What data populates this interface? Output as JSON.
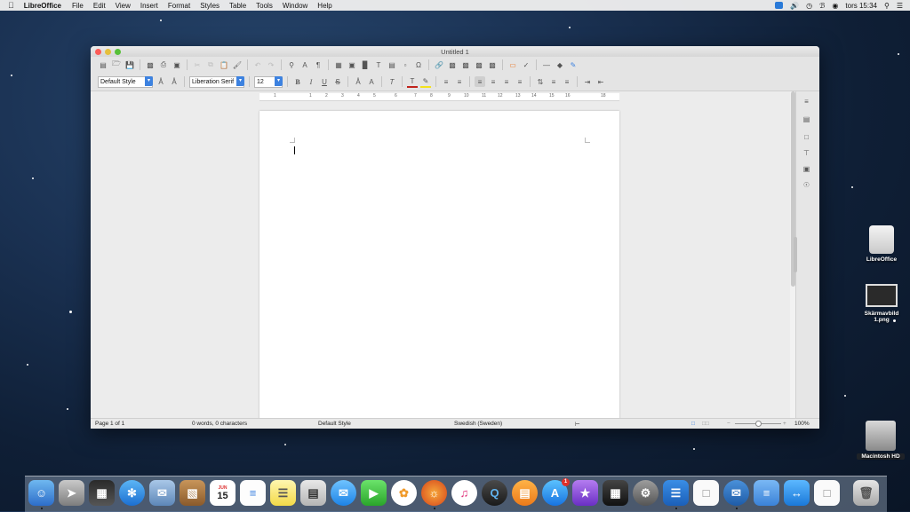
{
  "menubar": {
    "app_name": "LibreOffice",
    "menus": [
      "File",
      "Edit",
      "View",
      "Insert",
      "Format",
      "Styles",
      "Table",
      "Tools",
      "Window",
      "Help"
    ],
    "clock": "tors 15:34"
  },
  "window": {
    "title": "Untitled 1",
    "paragraph_style": "Default Style",
    "font_name": "Liberation Serif",
    "font_size": "12",
    "ruler_numbers": [
      "1",
      "1",
      "2",
      "3",
      "4",
      "5",
      "6",
      "7",
      "8",
      "9",
      "10",
      "11",
      "12",
      "13",
      "14",
      "15",
      "16",
      "18"
    ]
  },
  "statusbar": {
    "page": "Page 1 of 1",
    "words": "0 words, 0 characters",
    "style": "Default Style",
    "language": "Swedish (Sweden)",
    "zoom": "100%"
  },
  "desktop": {
    "libreoffice_label": "LibreOffice",
    "screenshot_label_line1": "Skärmavbild",
    "screenshot_label_line2": "1.png",
    "hd_label": "Macintosh HD"
  },
  "dock": {
    "calendar_month": "JUN",
    "calendar_day": "15",
    "appstore_badge": "1"
  },
  "colors": {
    "accent": "#3d82e0",
    "close": "#fc5b57",
    "minimize": "#e5bf3c",
    "maximize": "#57c038"
  }
}
